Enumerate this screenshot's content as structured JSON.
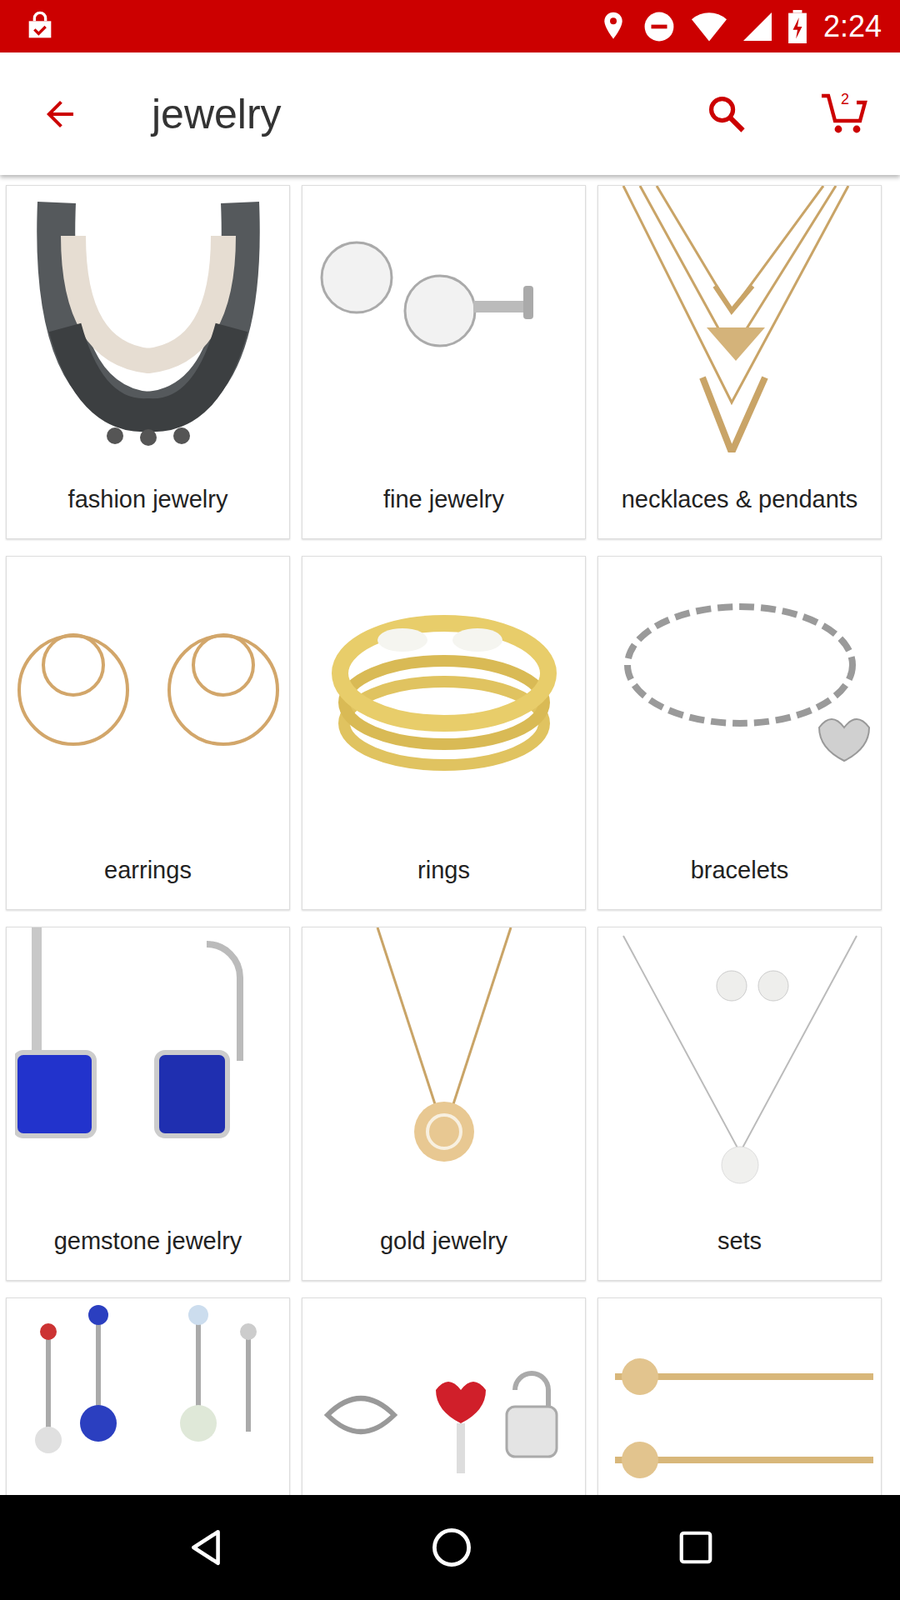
{
  "status_bar": {
    "time": "2:24"
  },
  "app_bar": {
    "title": "jewelry",
    "cart_count": "2"
  },
  "tiles": [
    {
      "label": "fashion jewelry"
    },
    {
      "label": "fine jewelry"
    },
    {
      "label": "necklaces & pendants"
    },
    {
      "label": "earrings"
    },
    {
      "label": "rings"
    },
    {
      "label": "bracelets"
    },
    {
      "label": "gemstone jewelry"
    },
    {
      "label": "gold jewelry"
    },
    {
      "label": "sets"
    },
    {
      "label": ""
    },
    {
      "label": ""
    },
    {
      "label": ""
    }
  ]
}
